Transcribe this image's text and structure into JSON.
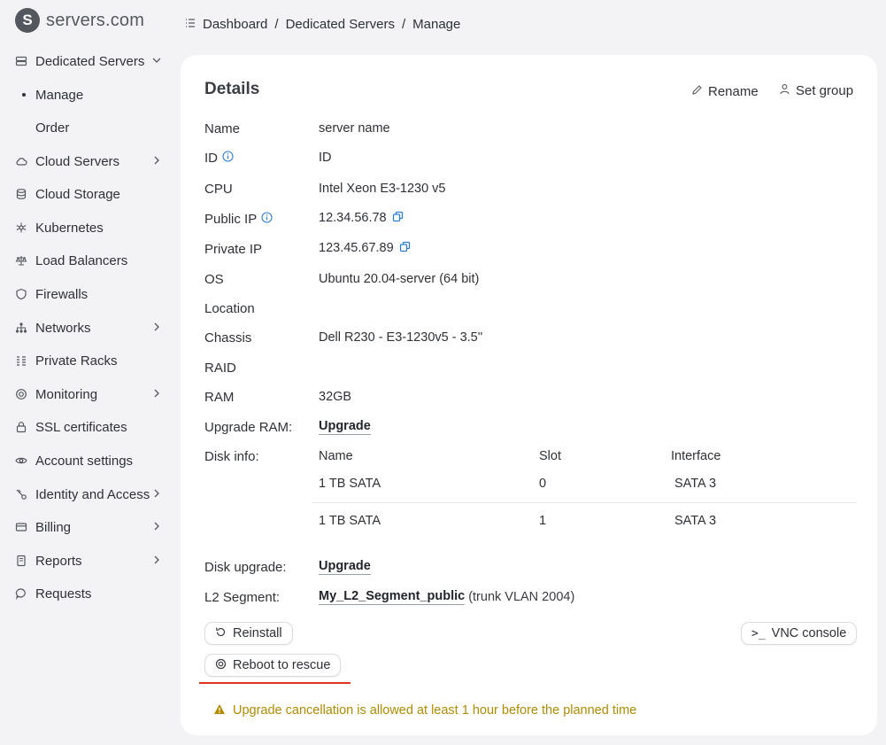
{
  "brand": {
    "name": "servers.com",
    "mark": "S"
  },
  "sidebar": {
    "items": [
      {
        "label": "Dedicated Servers",
        "icon": "server-icon",
        "chevron": "down"
      },
      {
        "label": "Manage",
        "icon": "bullet",
        "sub": true
      },
      {
        "label": "Order",
        "sub": true
      },
      {
        "label": "Cloud Servers",
        "icon": "cloud-icon",
        "chevron": "right"
      },
      {
        "label": "Cloud Storage",
        "icon": "storage-icon"
      },
      {
        "label": "Kubernetes",
        "icon": "kubernetes-icon"
      },
      {
        "label": "Load Balancers",
        "icon": "scale-icon"
      },
      {
        "label": "Firewalls",
        "icon": "shield-icon"
      },
      {
        "label": "Networks",
        "icon": "network-icon",
        "chevron": "right"
      },
      {
        "label": "Private Racks",
        "icon": "rack-icon"
      },
      {
        "label": "Monitoring",
        "icon": "monitor-icon",
        "chevron": "right"
      },
      {
        "label": "SSL certificates",
        "icon": "lock-icon"
      },
      {
        "label": "Account settings",
        "icon": "eye-icon"
      },
      {
        "label": "Identity and Access",
        "icon": "key-icon",
        "chevron": "right"
      },
      {
        "label": "Billing",
        "icon": "card-icon",
        "chevron": "right"
      },
      {
        "label": "Reports",
        "icon": "report-icon",
        "chevron": "right"
      },
      {
        "label": "Requests",
        "icon": "chat-icon"
      }
    ]
  },
  "breadcrumb": {
    "items": [
      "Dashboard",
      "Dedicated Servers",
      "Manage"
    ],
    "separator": "/"
  },
  "details": {
    "title": "Details",
    "rename_label": "Rename",
    "set_group_label": "Set group",
    "rows": {
      "name": {
        "label": "Name",
        "value": "server name"
      },
      "id": {
        "label": "ID",
        "value": "ID"
      },
      "cpu": {
        "label": "CPU",
        "value": "Intel Xeon E3-1230 v5"
      },
      "public_ip": {
        "label": "Public IP",
        "value": "12.34.56.78"
      },
      "private_ip": {
        "label": "Private IP",
        "value": "123.45.67.89"
      },
      "os": {
        "label": "OS",
        "value": "Ubuntu 20.04-server (64 bit)"
      },
      "location": {
        "label": "Location",
        "value": ""
      },
      "chassis": {
        "label": "Chassis",
        "value": "Dell R230 - E3-1230v5 - 3.5''"
      },
      "raid": {
        "label": "RAID",
        "value": ""
      },
      "ram": {
        "label": "RAM",
        "value": "32GB"
      },
      "upgrade_ram": {
        "label": "Upgrade RAM:",
        "link": "Upgrade"
      },
      "disk_info": {
        "label": "Disk info:"
      },
      "disk_upgrade": {
        "label": "Disk upgrade:",
        "link": "Upgrade"
      },
      "l2_segment": {
        "label": "L2 Segment:",
        "link": "My_L2_Segment_public",
        "suffix": "(trunk VLAN 2004)"
      }
    },
    "disks": {
      "columns": [
        "Name",
        "Slot",
        "Interface"
      ],
      "rows": [
        [
          "1 TB SATA",
          "0",
          "SATA 3"
        ],
        [
          "1 TB SATA",
          "1",
          "SATA 3"
        ]
      ]
    },
    "buttons": {
      "reinstall": "Reinstall",
      "vnc_console": "VNC console",
      "reboot_rescue": "Reboot to rescue"
    },
    "warning": "Upgrade cancellation is allowed at least 1 hour before the planned time"
  },
  "colors": {
    "background": "#f3f3f5",
    "card": "#ffffff",
    "accent_blue": "#2f7fd1",
    "warning": "#b08b00",
    "highlight_red": "#e0341f"
  }
}
